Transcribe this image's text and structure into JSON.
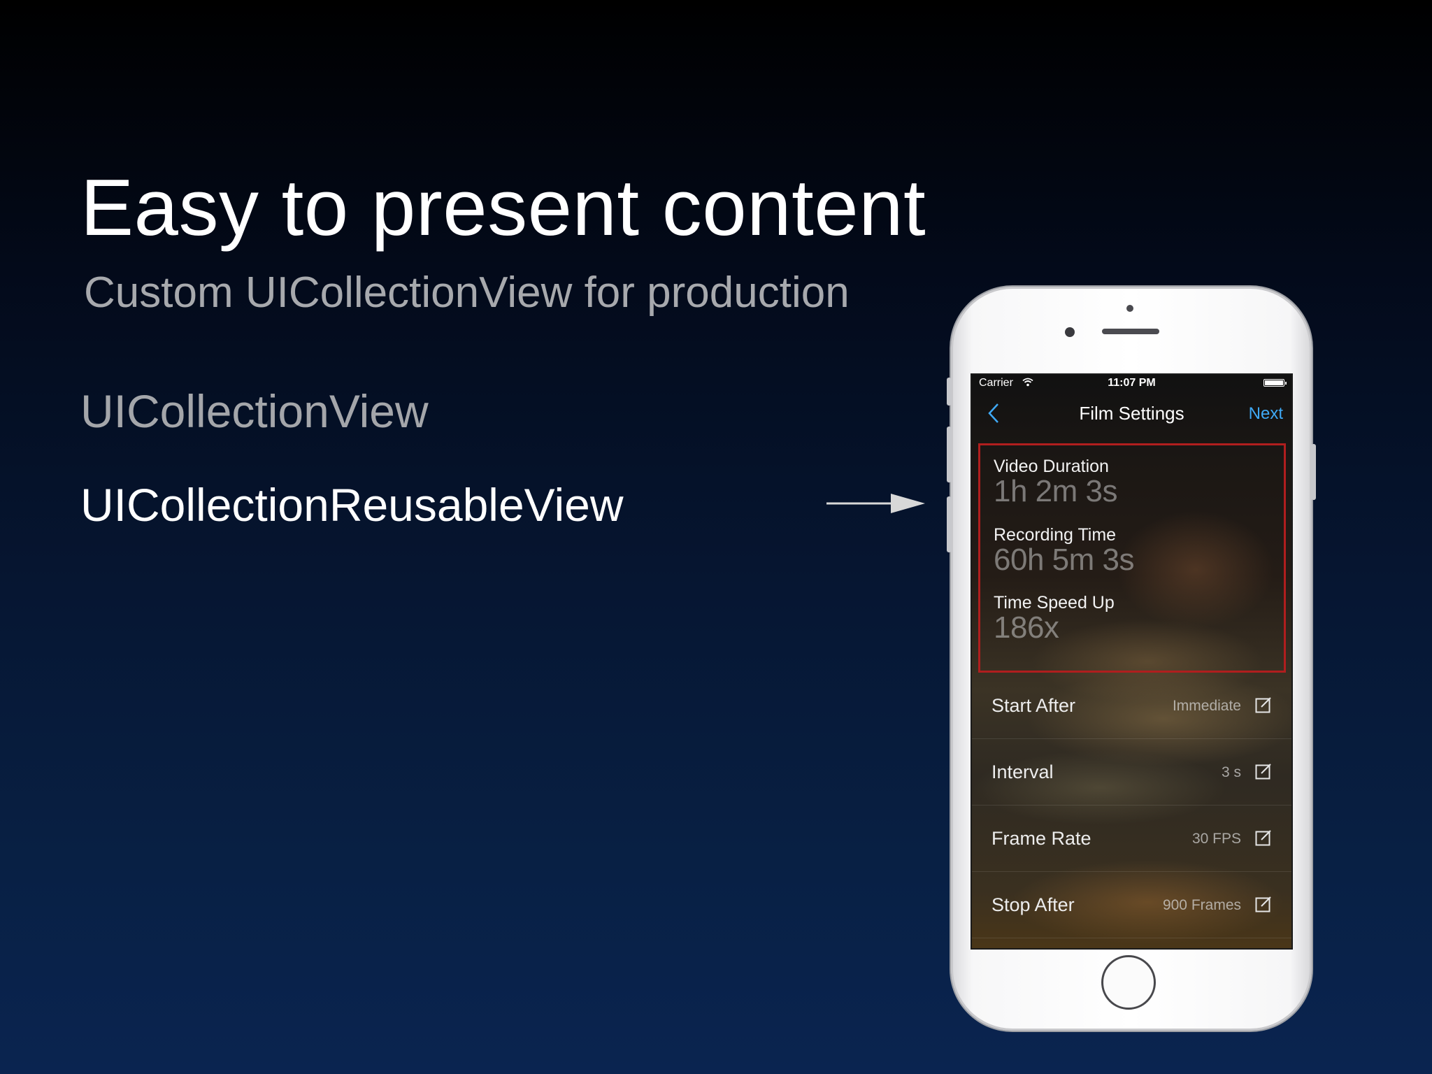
{
  "slide": {
    "title": "Easy to present content",
    "subtitle": "Custom UICollectionView for production",
    "bullets": [
      "UICollectionView",
      "UICollectionReusableView"
    ]
  },
  "phone": {
    "status_bar": {
      "carrier": "Carrier",
      "time": "11:07 PM"
    },
    "nav": {
      "title": "Film Settings",
      "next": "Next"
    },
    "header": {
      "stats": [
        {
          "label": "Video Duration",
          "value": "1h 2m 3s"
        },
        {
          "label": "Recording Time",
          "value": "60h 5m 3s"
        },
        {
          "label": "Time Speed Up",
          "value": "186x"
        }
      ]
    },
    "settings": [
      {
        "label": "Start After",
        "value": "Immediate"
      },
      {
        "label": "Interval",
        "value": "3 s"
      },
      {
        "label": "Frame Rate",
        "value": "30 FPS"
      },
      {
        "label": "Stop After",
        "value": "900 Frames"
      }
    ]
  },
  "colors": {
    "accent": "#3fa9f5",
    "highlight_border": "#b01e1e",
    "background_top": "#000000",
    "background_bottom": "#0a2450"
  },
  "icons": [
    "wifi-icon",
    "battery-icon",
    "chevron-left-icon",
    "edit-icon",
    "arrow-right-icon"
  ]
}
